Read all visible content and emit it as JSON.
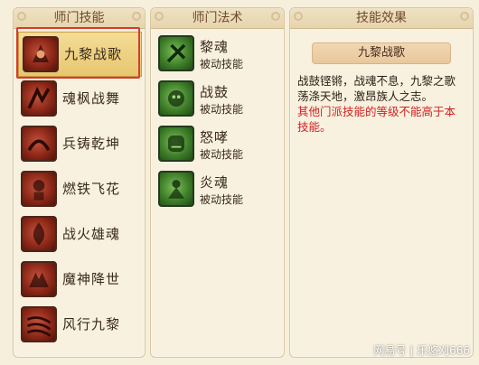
{
  "panels": {
    "school_skills": {
      "title": "师门技能",
      "items": [
        {
          "name": "九黎战歌",
          "icon": "war-song-icon"
        },
        {
          "name": "魂枫战舞",
          "icon": "soul-maple-dance-icon"
        },
        {
          "name": "兵铸乾坤",
          "icon": "forge-weapon-icon"
        },
        {
          "name": "燃铁飞花",
          "icon": "burning-iron-icon"
        },
        {
          "name": "战火雄魂",
          "icon": "war-fire-soul-icon"
        },
        {
          "name": "魔神降世",
          "icon": "demon-descend-icon"
        },
        {
          "name": "风行九黎",
          "icon": "wind-walk-icon"
        }
      ]
    },
    "school_spells": {
      "title": "师门法术",
      "items": [
        {
          "name": "黎魂",
          "type": "被动技能",
          "icon": "li-soul-icon"
        },
        {
          "name": "战鼓",
          "type": "被动技能",
          "icon": "war-drum-icon"
        },
        {
          "name": "怒哮",
          "type": "被动技能",
          "icon": "roar-icon"
        },
        {
          "name": "炎魂",
          "type": "被动技能",
          "icon": "flame-soul-icon"
        }
      ]
    },
    "skill_effect": {
      "title": "技能效果",
      "skill_name": "九黎战歌",
      "description": "战鼓铿锵，战魂不息，九黎之歌荡涤天地，激昂族人之志。",
      "note": "其他门派技能的等级不能高于本技能。"
    }
  },
  "watermark": "网易号 | 乐悠刈666",
  "colors": {
    "highlight": "#d93a2c",
    "note": "#d42020"
  }
}
